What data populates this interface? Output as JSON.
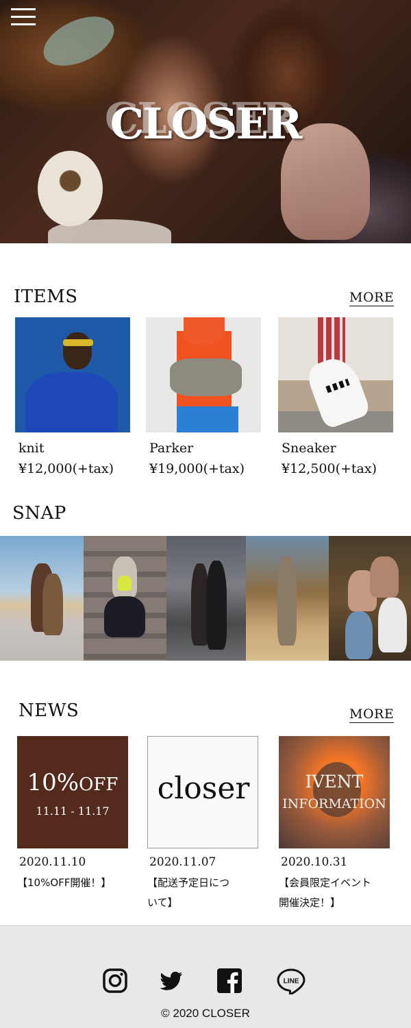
{
  "header": {
    "brand": "CLOSER"
  },
  "items_section": {
    "title": "ITEMS",
    "more_label": "MORE",
    "items": [
      {
        "name": "knit",
        "price": "¥12,000(+tax)"
      },
      {
        "name": "Parker",
        "price": "¥19,000(+tax)"
      },
      {
        "name": "Sneaker",
        "price": "¥12,500(+tax)"
      }
    ]
  },
  "snap_section": {
    "title": "SNAP"
  },
  "news_section": {
    "title": "NEWS",
    "more_label": "MORE",
    "posts": [
      {
        "thumb_line1": "10%",
        "thumb_line1b": "OFF",
        "thumb_line2": "11.11 - 11.17",
        "date": "2020.11.10",
        "text_line1": "【10%OFF開催！】",
        "text_line2": ""
      },
      {
        "thumb_line1": "closer",
        "date": "2020.11.07",
        "text_line1": "【配送予定日につ",
        "text_line2": "いて】"
      },
      {
        "thumb_line1": "IVENT",
        "thumb_line2": "INFORMATION",
        "date": "2020.10.31",
        "text_line1": "【会員限定イベント",
        "text_line2": "開催決定！】"
      }
    ]
  },
  "footer": {
    "social": [
      "instagram-icon",
      "twitter-icon",
      "facebook-icon",
      "line-icon"
    ],
    "copyright": "© 2020 CLOSER"
  },
  "colors": {
    "sale_bg": "#542a1d",
    "footer_bg": "#e9e8e8"
  }
}
